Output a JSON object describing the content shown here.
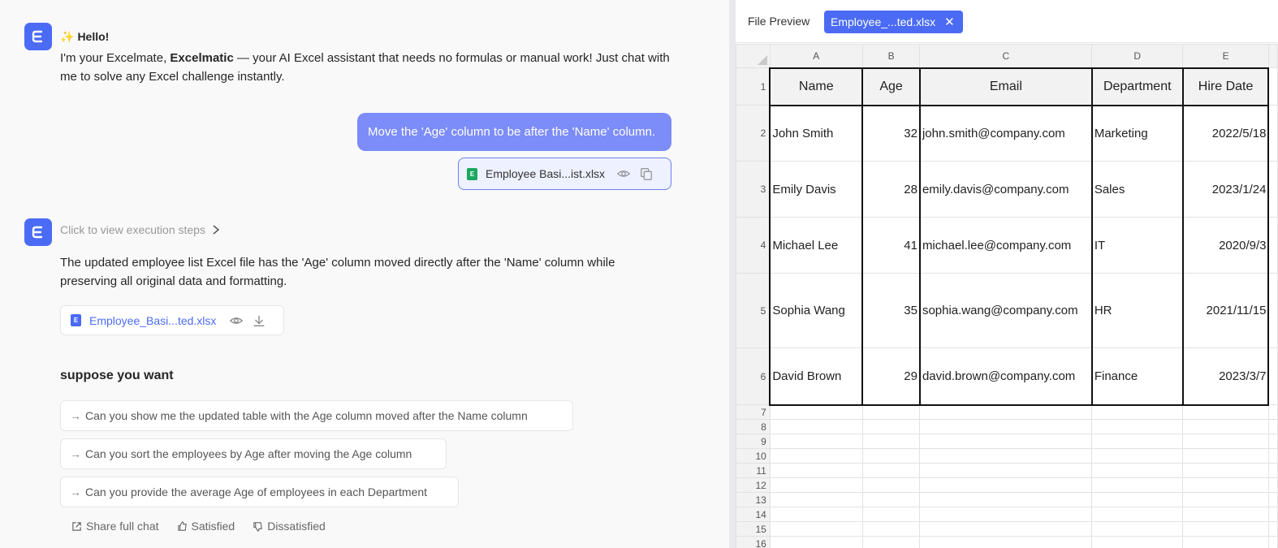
{
  "chat": {
    "hello_icon": "sparkle-icon",
    "hello": "Hello!",
    "intro_prefix": "I'm your Excelmate, ",
    "intro_brand": "Excelmatic",
    "intro_suffix": " — your AI Excel assistant that needs no formulas or manual work! Just chat with me to solve any Excel challenge instantly.",
    "user_message": "Move the 'Age' column to be after the 'Name' column.",
    "user_file": "Employee Basi...ist.xlsx",
    "exec_steps": "Click to view execution steps",
    "answer": "The updated employee list Excel file has the 'Age' column moved directly after the 'Name' column while preserving all original data and formatting.",
    "output_file": "Employee_Basi...ted.xlsx",
    "suggest_title": "suppose you want",
    "suggestions": [
      "Can you show me the updated table with the Age column moved after the Name column",
      "Can you sort the employees by Age after moving the Age column",
      "Can you provide the average Age of employees in each Department"
    ],
    "footer": {
      "share": "Share full chat",
      "satisfied": "Satisfied",
      "dissatisfied": "Dissatisfied"
    }
  },
  "preview": {
    "title": "File Preview",
    "tab_label": "Employee_...ted.xlsx",
    "columns": [
      "A",
      "B",
      "C",
      "D",
      "E"
    ],
    "headers": [
      "Name",
      "Age",
      "Email",
      "Department",
      "Hire Date"
    ],
    "rows": [
      [
        "John Smith",
        "32",
        "john.smith@company.com",
        "Marketing",
        "2022/5/18"
      ],
      [
        "Emily Davis",
        "28",
        "emily.davis@company.com",
        "Sales",
        "2023/1/24"
      ],
      [
        "Michael Lee",
        "41",
        "michael.lee@company.com",
        "IT",
        "2020/9/3"
      ],
      [
        "Sophia Wang",
        "35",
        "sophia.wang@company.com",
        "HR",
        "2021/11/15"
      ],
      [
        "David Brown",
        "29",
        "david.brown@company.com",
        "Finance",
        "2023/3/7"
      ]
    ],
    "empty_row_numbers": [
      "7",
      "8",
      "9",
      "10",
      "11",
      "12",
      "13",
      "14",
      "15",
      "16"
    ],
    "data_row_numbers": [
      "1",
      "2",
      "3",
      "4",
      "5",
      "6"
    ]
  },
  "colors": {
    "accent": "#4b6bf5",
    "user_bubble": "#7c8cf8"
  }
}
